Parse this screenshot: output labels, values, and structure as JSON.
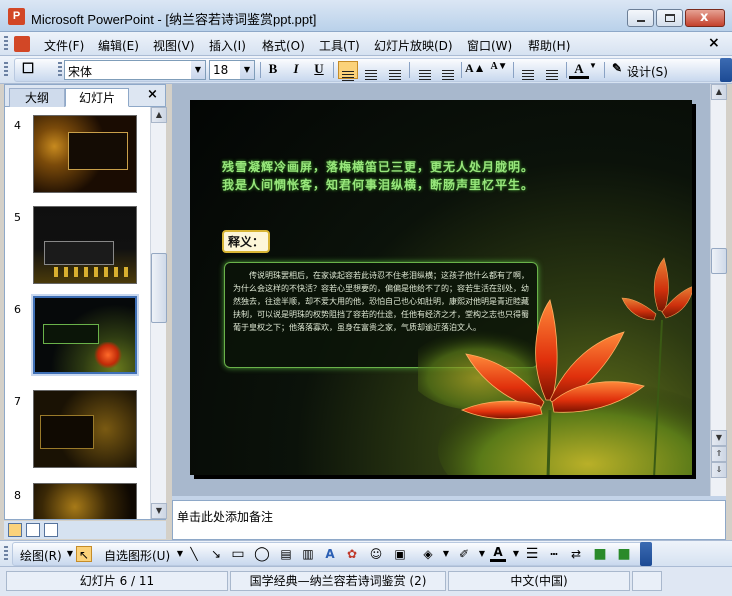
{
  "window": {
    "app_icon": "P",
    "title": "Microsoft PowerPoint - [纳兰容若诗词鉴赏ppt.ppt]",
    "minimize_icon": "minimize-icon",
    "maximize_icon": "maximize-icon",
    "close_icon": "close-icon",
    "close_glyph": "x"
  },
  "menubar": {
    "items": [
      {
        "label": "文件(F)"
      },
      {
        "label": "编辑(E)"
      },
      {
        "label": "视图(V)"
      },
      {
        "label": "插入(I)"
      },
      {
        "label": "格式(O)"
      },
      {
        "label": "工具(T)"
      },
      {
        "label": "幻灯片放映(D)"
      },
      {
        "label": "窗口(W)"
      },
      {
        "label": "帮助(H)"
      }
    ],
    "doc_close_glyph": "×"
  },
  "toolbar": {
    "font_name": "宋体",
    "font_size": "18",
    "bold": "B",
    "italic": "I",
    "underline": "U",
    "font_color_glyph": "A",
    "design_label": "设计(S)",
    "align_left_active": true
  },
  "left_pane": {
    "tabs": [
      {
        "label": "大纲",
        "active": false
      },
      {
        "label": "幻灯片",
        "active": true
      }
    ],
    "close_glyph": "×",
    "thumbnails": [
      {
        "number": "4"
      },
      {
        "number": "5"
      },
      {
        "number": "6",
        "selected": true
      },
      {
        "number": "7"
      },
      {
        "number": "8"
      }
    ]
  },
  "slide": {
    "poem": "残雪凝辉冷画屏，落梅横笛已三更，更无人处月胧明。我是人间惆怅客，知君何事泪纵横，断肠声里忆平生。",
    "label": "释义：",
    "explanation": "传说明珠罢相后，在家读起容若此诗忍不住老泪纵横；这孩子他什么都有了啊，为什么会这样的不快活？容若心里想要的，偏偏是他给不了的；容若生活在别处，幼然独去，往途半顺，却不爱大用的他，恐怕自己也心如肚明，康熙对他明是青近睦藏扶制，可以说是明珠的权势阻挡了容若的仕途，任他有经济之才，堂构之志也只得蜀葡于皇权之下；他落落寡欢，虽身在富贵之家，气质却逾近落泊文人。"
  },
  "notes": {
    "placeholder": "单击此处添加备注"
  },
  "drawing_toolbar": {
    "draw_label": "绘图(R)",
    "autoshapes_label": "自选图形(U)"
  },
  "statusbar": {
    "slide_position": "幻灯片 6 / 11",
    "template": "国学经典—纳兰容若诗词鉴赏 (2)",
    "language": "中文(中国)"
  },
  "colors": {
    "selection_border": "#3e6fb5",
    "poem_text": "#98e67c",
    "active_button": "#fbd27a"
  }
}
